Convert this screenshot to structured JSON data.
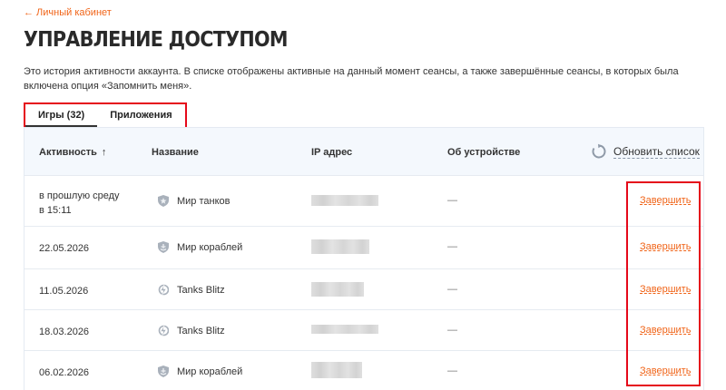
{
  "back_link": "← Личный кабинет",
  "page_title": "УПРАВЛЕНИЕ ДОСТУПОМ",
  "description": "Это история активности аккаунта. В списке отображены активные на данный момент сеансы, а также завершённые сеансы, в которых была включена опция «Запомнить меня».",
  "tabs": [
    {
      "label": "Игры (32)",
      "active": true
    },
    {
      "label": "Приложения",
      "active": false
    }
  ],
  "table": {
    "headers": {
      "activity": "Активность",
      "sort_arrow": "↑",
      "name": "Название",
      "ip": "IP адрес",
      "device": "Об устройстве"
    },
    "refresh_label": "Обновить список",
    "rows": [
      {
        "activity": "в прошлую среду\nв 15:11",
        "game": "Мир танков",
        "icon": "tank-shield-icon",
        "device": "—",
        "action": "Завершить"
      },
      {
        "activity": "22.05.2026",
        "game": "Мир кораблей",
        "icon": "ship-shield-icon",
        "device": "—",
        "action": "Завершить"
      },
      {
        "activity": "11.05.2026",
        "game": "Tanks Blitz",
        "icon": "blitz-icon",
        "device": "—",
        "action": "Завершить"
      },
      {
        "activity": "18.03.2026",
        "game": "Tanks Blitz",
        "icon": "blitz-icon",
        "device": "—",
        "action": "Завершить"
      },
      {
        "activity": "06.02.2026",
        "game": "Мир кораблей",
        "icon": "ship-shield-icon",
        "device": "—",
        "action": "Завершить"
      }
    ]
  },
  "colors": {
    "accent": "#f06418",
    "highlight": "#e5091a",
    "table_bg": "#f4f8fd"
  }
}
